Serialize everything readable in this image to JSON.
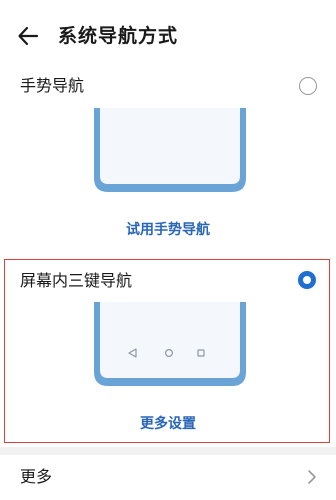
{
  "header": {
    "title": "系统导航方式",
    "back_icon": "arrow-left-icon"
  },
  "options": [
    {
      "label": "手势导航",
      "selected": false,
      "action_label": "试用手势导航"
    },
    {
      "label": "屏幕内三键导航",
      "selected": true,
      "action_label": "更多设置",
      "nav_keys": [
        "back-triangle-icon",
        "home-circle-icon",
        "recent-square-icon"
      ]
    }
  ],
  "more": {
    "label": "更多",
    "icon": "chevron-right-icon"
  },
  "colors": {
    "accent": "#1f6fd1",
    "phone_frame": "#6aa3d6",
    "phone_screen": "#f4f8fc",
    "highlight": "#d8413e",
    "link": "#2a66b7"
  }
}
